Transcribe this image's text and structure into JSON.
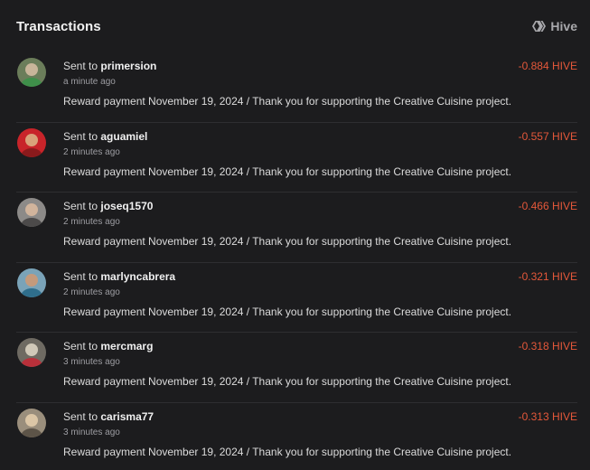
{
  "header": {
    "title": "Transactions",
    "brand_label": "Hive",
    "brand_icon": "hive-logo-icon"
  },
  "colors": {
    "background": "#1c1c1e",
    "divider": "#2e2e31",
    "amount_negative": "#e5583a",
    "muted_text": "#9d9da2"
  },
  "transactions": [
    {
      "prefix": "Sent to",
      "user": "primersion",
      "time": "a minute ago",
      "memo": "Reward payment November 19, 2024 / Thank you for supporting the Creative Cuisine project.",
      "amount": "-0.884 HIVE",
      "avatar_colors": [
        "#6b7d5a",
        "#3f8f4a",
        "#c9b59a"
      ]
    },
    {
      "prefix": "Sent to",
      "user": "aguamiel",
      "time": "2 minutes ago",
      "memo": "Reward payment November 19, 2024 / Thank you for supporting the Creative Cuisine project.",
      "amount": "-0.557 HIVE",
      "avatar_colors": [
        "#c8242a",
        "#8a1a1c",
        "#d9a27a"
      ]
    },
    {
      "prefix": "Sent to",
      "user": "joseq1570",
      "time": "2 minutes ago",
      "memo": "Reward payment November 19, 2024 / Thank you for supporting the Creative Cuisine project.",
      "amount": "-0.466 HIVE",
      "avatar_colors": [
        "#8c8a88",
        "#4c4a4a",
        "#d1b49c"
      ]
    },
    {
      "prefix": "Sent to",
      "user": "marlyncabrera",
      "time": "2 minutes ago",
      "memo": "Reward payment November 19, 2024 / Thank you for supporting the Creative Cuisine project.",
      "amount": "-0.321 HIVE",
      "avatar_colors": [
        "#7aa3b8",
        "#2f6e8c",
        "#c49a7c"
      ]
    },
    {
      "prefix": "Sent to",
      "user": "mercmarg",
      "time": "3 minutes ago",
      "memo": "Reward payment November 19, 2024 / Thank you for supporting the Creative Cuisine project.",
      "amount": "-0.318 HIVE",
      "avatar_colors": [
        "#6e6a62",
        "#b8303a",
        "#d0c8b8"
      ]
    },
    {
      "prefix": "Sent to",
      "user": "carisma77",
      "time": "3 minutes ago",
      "memo": "Reward payment November 19, 2024 / Thank you for supporting the Creative Cuisine project.",
      "amount": "-0.313 HIVE",
      "avatar_colors": [
        "#9a8e7c",
        "#5d5448",
        "#dcc6a6"
      ]
    }
  ]
}
